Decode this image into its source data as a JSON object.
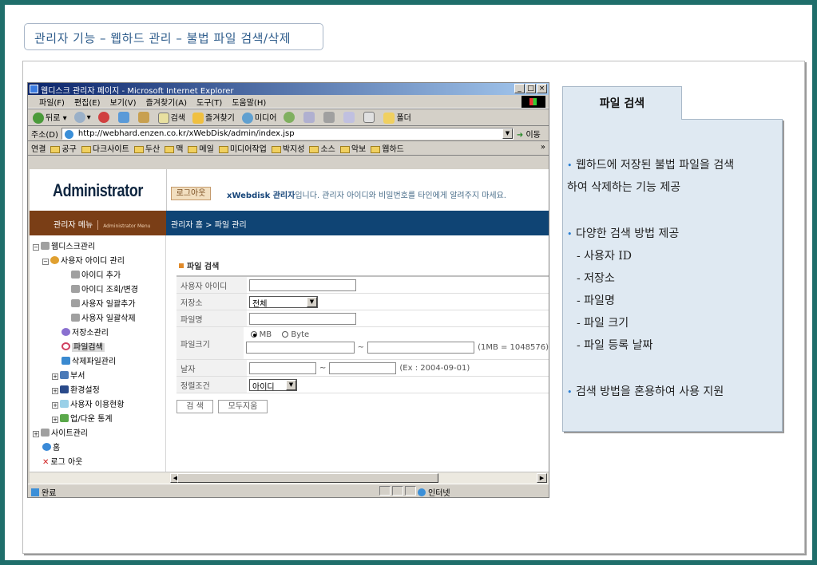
{
  "slide_title": "관리자 기능 – 웹하드 관리 – 불법 파일 검색/삭제",
  "browser": {
    "title": "웹디스크 관리자 페이지 - Microsoft Internet Explorer",
    "win_buttons": [
      "_",
      "□",
      "×"
    ],
    "menu": [
      "파일(F)",
      "편집(E)",
      "보기(V)",
      "즐겨찾기(A)",
      "도구(T)",
      "도움말(H)"
    ],
    "toolbar": {
      "back": "뒤로",
      "search": "검색",
      "favorites": "즐겨찾기",
      "media": "미디어",
      "folder": "폴더"
    },
    "address_label": "주소(D)",
    "address_url": "http://webhard.enzen.co.kr/xWebDisk/admin/index.jsp",
    "go_label": "이동",
    "links_label": "연결",
    "links": [
      "공구",
      "다크사이트",
      "두산",
      "맥",
      "메일",
      "미디어작업",
      "박지성",
      "소스",
      "악보",
      "웹하드"
    ],
    "status_text": "완료",
    "zone_text": "인터넷"
  },
  "page": {
    "logo": "Administrator",
    "logout": "로그아웃",
    "welcome_brand": "xWebdisk 관리자",
    "welcome_rest": "입니다. 관리자 아이디와 비밀번호를 타인에게 알려주지 마세요.",
    "menu_title": "관리자 메뉴",
    "menu_sub": "Administrator Menu",
    "breadcrumb": "관리자 홈 > 파일 관리",
    "tree": [
      "웹디스크관리",
      "사용자 아이디 관리",
      "아이디 추가",
      "아이디 조회/변경",
      "사용자 일괄추가",
      "사용자 일괄삭제",
      "저장소관리",
      "파일검색",
      "삭제파일관리",
      "부서",
      "환경설정",
      "사용자 이용현황",
      "업/다운 통계",
      "사이트관리",
      "홈",
      "로그 아웃"
    ],
    "section_title": "파일 검색",
    "form": {
      "user_id": "사용자 아이디",
      "storage": "저장소",
      "storage_value": "전체",
      "filename": "파일명",
      "filesize": "파일크기",
      "unit_mb": "MB",
      "unit_byte": "Byte",
      "tilde": "~",
      "size_hint": "(1MB = 1048576)",
      "date": "날자",
      "date_hint": "(Ex : 2004-09-01)",
      "sort": "정렬조건",
      "sort_value": "아이디"
    },
    "buttons": {
      "search": "검  색",
      "clear": "모두지움"
    }
  },
  "info": {
    "tab": "파일 검색",
    "bullet": "•",
    "lines": [
      "웹하드에 저장된 불법 파일을 검색",
      "하여 삭제하는 기능 제공",
      "다양한 검색 방법 제공",
      "- 사용자 ID",
      "- 저장소",
      "- 파일명",
      "- 파일 크기",
      "- 파일 등록 날짜",
      "검색 방법을 혼용하여 사용 지원"
    ]
  },
  "colors": {
    "teal_border": "#1f6e6b",
    "brown_bar": "#7a3e16",
    "navy_bar": "#0f4474",
    "info_bg": "#dfe9f2",
    "accent_orange": "#e08a2a"
  }
}
